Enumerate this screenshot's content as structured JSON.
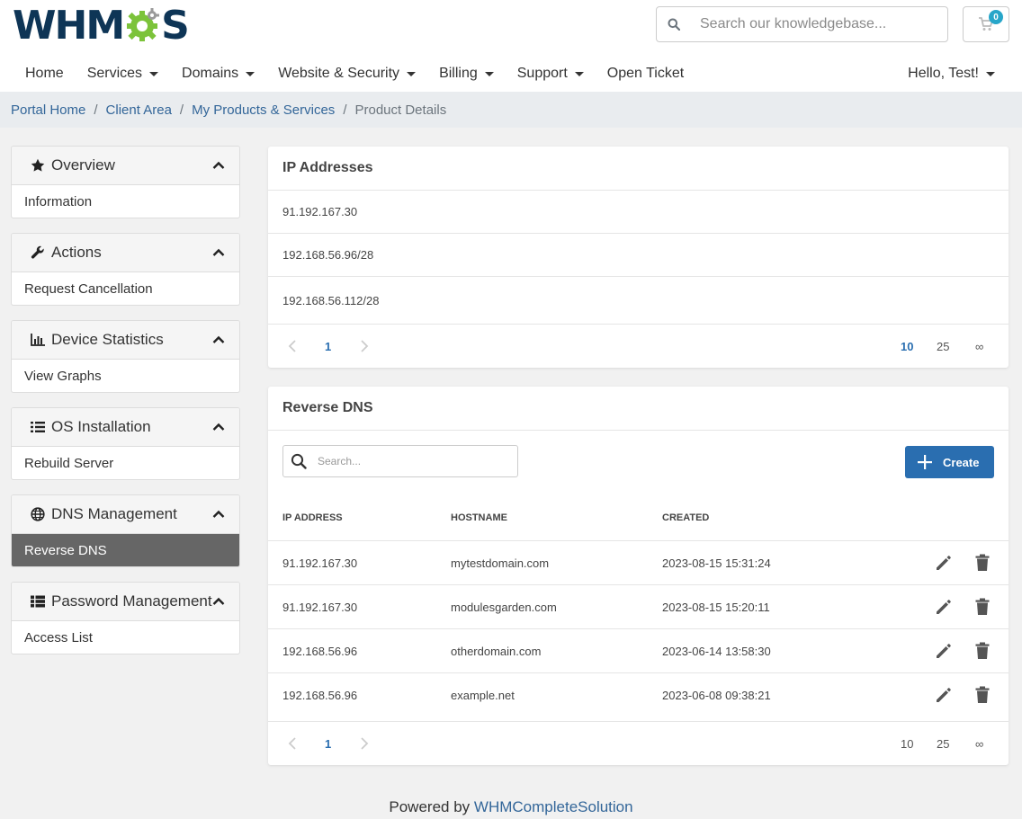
{
  "brand": {
    "logo_left": "WHM",
    "logo_right": "S"
  },
  "header": {
    "search_placeholder": "Search our knowledgebase...",
    "cart_count": "0"
  },
  "nav": {
    "home": "Home",
    "services": "Services",
    "domains": "Domains",
    "website_security": "Website & Security",
    "billing": "Billing",
    "support": "Support",
    "open_ticket": "Open Ticket",
    "user": "Hello, Test!"
  },
  "breadcrumb": {
    "items": [
      "Portal Home",
      "Client Area",
      "My Products & Services"
    ],
    "active": "Product Details"
  },
  "sidebar": {
    "overview": {
      "title": "Overview",
      "item": "Information"
    },
    "actions": {
      "title": "Actions",
      "item": "Request Cancellation"
    },
    "device_statistics": {
      "title": "Device Statistics",
      "item": "View Graphs"
    },
    "os_installation": {
      "title": "OS Installation",
      "item": "Rebuild Server"
    },
    "dns_management": {
      "title": "DNS Management",
      "item": "Reverse DNS"
    },
    "password_management": {
      "title": "Password Management",
      "item": "Access List"
    }
  },
  "ip_addresses": {
    "title": "IP Addresses",
    "rows": [
      "91.192.167.30",
      "192.168.56.96/28",
      "192.168.56.112/28"
    ],
    "page": "1",
    "sizes": [
      "10",
      "25",
      "∞"
    ]
  },
  "reverse_dns": {
    "title": "Reverse DNS",
    "search_placeholder": "Search...",
    "create_label": "Create",
    "columns": [
      "IP ADDRESS",
      "HOSTNAME",
      "CREATED"
    ],
    "rows": [
      {
        "ip": "91.192.167.30",
        "hostname": "mytestdomain.com",
        "created": "2023-08-15 15:31:24"
      },
      {
        "ip": "91.192.167.30",
        "hostname": "modulesgarden.com",
        "created": "2023-08-15 15:20:11"
      },
      {
        "ip": "192.168.56.96",
        "hostname": "otherdomain.com",
        "created": "2023-06-14 13:58:30"
      },
      {
        "ip": "192.168.56.96",
        "hostname": "example.net",
        "created": "2023-06-08 09:38:21"
      }
    ],
    "page": "1",
    "sizes": [
      "10",
      "25",
      "∞"
    ]
  },
  "footer": {
    "prefix": "Powered by",
    "link": "WHMCompleteSolution"
  },
  "colors": {
    "primary": "#2a6eb0",
    "logo_navy": "#0e3556",
    "logo_green": "#7cc33a",
    "active_item": "#666666"
  }
}
